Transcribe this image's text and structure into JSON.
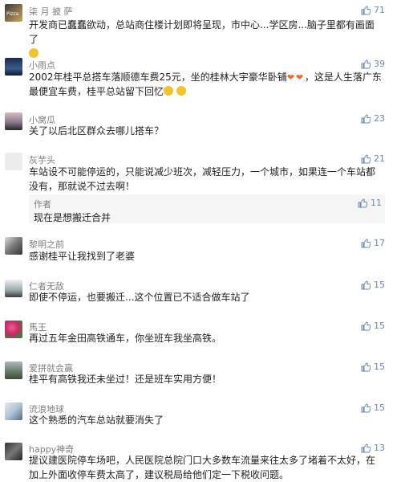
{
  "comments": [
    {
      "name": "柒 月 披 萨",
      "likes": "71",
      "text": "开发商已蠢蠢欲动，总站商住楼计划即将呈现，市中心...学区房...脑子里都有画面了"
    },
    {
      "name": "小雨点",
      "likes": "39",
      "text_line1": "2002年桂平总搭车落顺德车费25元，坐的桂林大宇豪华卧铺",
      "text_line1_tail": "，这是人生落广东",
      "text_line2": "最便宜车费，桂平总站留下回忆"
    },
    {
      "name": "小窝瓜",
      "likes": "23",
      "text": "关了以后北区群众去哪儿搭车？"
    },
    {
      "name": "灰芋头",
      "likes": "21",
      "text": "车站设不可能停运的，只能说减少班次，减轻压力，一个城市，如果连一个车站都没有，那就说不过去啊！",
      "reply": {
        "name": "作者",
        "likes": "11",
        "text": "现在是想搬迁合并"
      }
    },
    {
      "name": "黎明之前",
      "likes": "17",
      "text": "感谢桂平让我找到了老婆"
    },
    {
      "name": "仁者无敌",
      "likes": "15",
      "text": "即使不停运，也要搬迁...这个位置已不适合做车站了"
    },
    {
      "name": "馬王",
      "likes": "15",
      "text": "再过五年金田高铁通车，你坐班车我坐高铁。"
    },
    {
      "name": "爱拼就会赢",
      "likes": "15",
      "text": "桂平有高铁我还未坐过！还是班车实用方便！"
    },
    {
      "name": "流浪地球",
      "likes": "15",
      "text": "这个熟悉的汽车总站就要消失了"
    },
    {
      "name": "happy神奇",
      "likes": "13",
      "text": "提议建医院停车场吧，人民医院总院门口大多数车流量来往太多了堵着不太好，在加上外面收停车费太高了，建议税局给他们定一下税收问题。"
    }
  ],
  "icons": {
    "like": "thumbs-up-icon",
    "emoji": "smile-emoji-icon",
    "heart": "heart-emoji-icon"
  },
  "colors": {
    "like": "#6a88b6",
    "name": "#7d7d7d",
    "text": "#222222",
    "reply_bg": "#f5f5f5"
  }
}
